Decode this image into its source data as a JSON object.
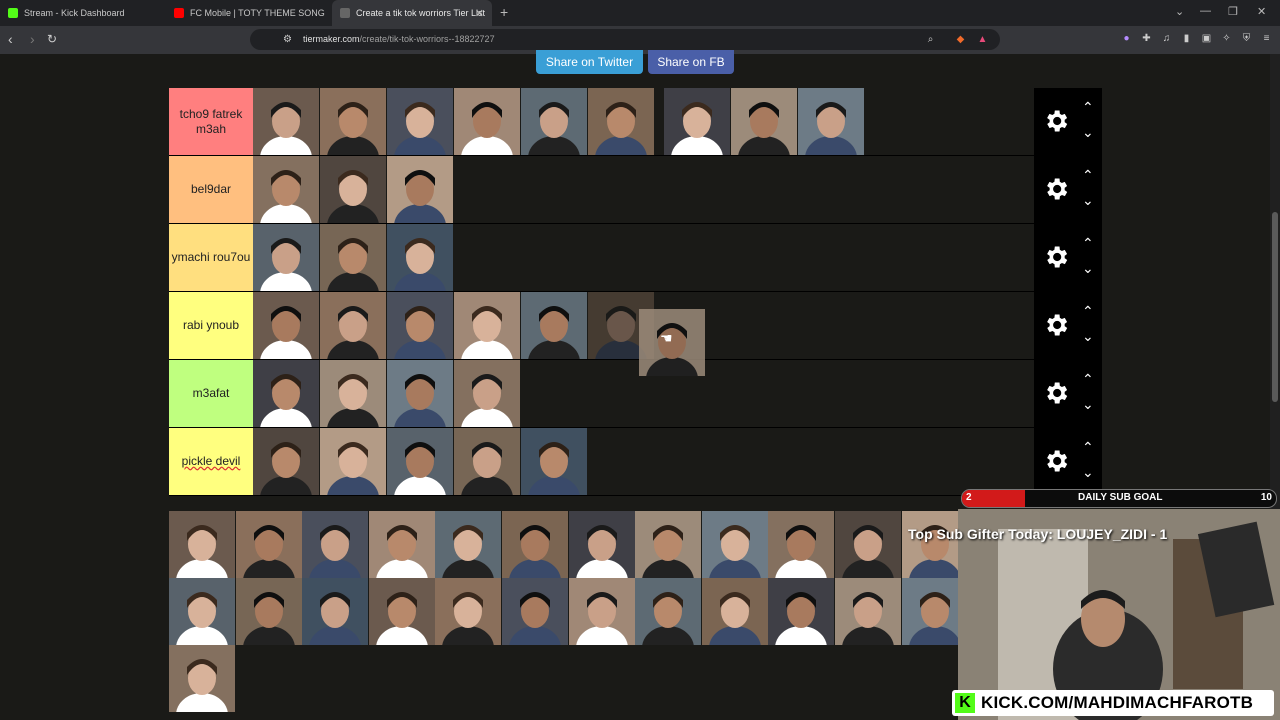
{
  "browser": {
    "tabs": [
      {
        "title": "Stream - Kick Dashboard",
        "favicon": "kick-icon",
        "color": "#53fc18"
      },
      {
        "title": "FC Mobile | TOTY THEME SONG",
        "favicon": "youtube-icon",
        "color": "#ff0000"
      },
      {
        "title": "Create a tik tok worriors Tier List",
        "favicon": "tiermaker-icon",
        "color": "#444444",
        "active": true
      }
    ],
    "url_host": "tiermaker.com",
    "url_path": "/create/tik-tok-worriors--18822727"
  },
  "share": {
    "twitter": "Share on Twitter",
    "fb": "Share on FB"
  },
  "tiers": [
    {
      "label": "tcho9 fatrek m3ah",
      "color": "#ff7f7f",
      "item_count": 9
    },
    {
      "label": "bel9dar",
      "color": "#ffbf7f",
      "item_count": 3
    },
    {
      "label": "ymachi rou7ou",
      "color": "#ffdf7f",
      "item_count": 3
    },
    {
      "label": "rabi ynoub",
      "color": "#ffff7f",
      "item_count": 6
    },
    {
      "label": "m3afat",
      "color": "#bfff7f",
      "item_count": 4
    },
    {
      "label": "pickle devil",
      "color": "#ffff7f",
      "item_count": 5
    }
  ],
  "pool_count": 25,
  "overlay": {
    "goal_current": "2",
    "goal_label": "DAILY SUB GOAL",
    "goal_target": "10",
    "goal_fraction": 0.2,
    "gifter": "Top Sub Gifter Today: LOUJEY_ZIDI - 1",
    "kick_url": "KICK.COM/MAHDIMACHFAROTB"
  }
}
